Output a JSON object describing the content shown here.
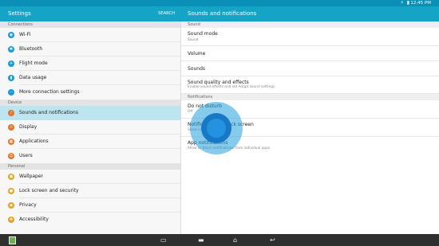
{
  "status_bar": {
    "time": "12:45 PM",
    "icons": "⚡ ▮"
  },
  "header": {
    "title": "Settings",
    "search_label": "SEARCH",
    "detail_title": "Sounds and notifications"
  },
  "left": {
    "sections": [
      {
        "label": "Connections",
        "items": [
          {
            "label": "Wi-Fi",
            "icon": "wifi-icon",
            "color": "#1a9ad6"
          },
          {
            "label": "Bluetooth",
            "icon": "bluetooth-icon",
            "color": "#1a9ad6"
          },
          {
            "label": "Flight mode",
            "icon": "airplane-icon",
            "color": "#1a9ad6"
          },
          {
            "label": "Data usage",
            "icon": "data-usage-icon",
            "color": "#1a9ad6"
          },
          {
            "label": "More connection settings",
            "icon": "more-connection-icon",
            "color": "#1a9ad6"
          }
        ]
      },
      {
        "label": "Device",
        "items": [
          {
            "label": "Sounds and notifications",
            "icon": "sound-icon",
            "color": "#e0752a",
            "selected": true
          },
          {
            "label": "Display",
            "icon": "display-icon",
            "color": "#e0752a"
          },
          {
            "label": "Applications",
            "icon": "applications-icon",
            "color": "#e0752a"
          },
          {
            "label": "Users",
            "icon": "users-icon",
            "color": "#e0752a"
          }
        ]
      },
      {
        "label": "Personal",
        "items": [
          {
            "label": "Wallpaper",
            "icon": "wallpaper-icon",
            "color": "#e0a52a"
          },
          {
            "label": "Lock screen and security",
            "icon": "lock-icon",
            "color": "#e0a52a"
          },
          {
            "label": "Privacy",
            "icon": "privacy-icon",
            "color": "#e0a52a"
          },
          {
            "label": "Accessibility",
            "icon": "accessibility-icon",
            "color": "#e0a52a"
          }
        ]
      }
    ]
  },
  "right": {
    "sound_section": "Sound",
    "sound_mode": {
      "title": "Sound mode",
      "value": "Sound"
    },
    "volume": "Volume",
    "sounds": "Sounds",
    "quality": {
      "title": "Sound quality and effects",
      "sub": "Enable sound effects and set Adapt sound settings."
    },
    "notif_section": "Notifications",
    "dnd": {
      "title": "Do not disturb",
      "sub": "Off"
    },
    "lockscreen": {
      "title": "Notifications on lock screen",
      "sub": "Show content"
    },
    "app_notif": {
      "title": "App notifications",
      "sub": "Allow or block notifications from individual apps."
    }
  },
  "nav": {
    "recent": "▭",
    "overview": "▬",
    "home": "⌂",
    "back": "↩"
  }
}
